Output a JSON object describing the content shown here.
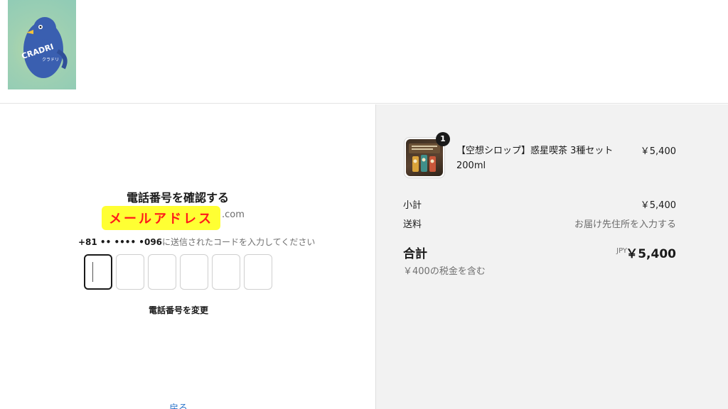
{
  "header": {
    "logo_text": "CRADRI",
    "logo_subtext": "クラドリ"
  },
  "verify": {
    "title": "電話番号を確認する",
    "email_masked": "メールアドレス",
    "email_domain": ".com",
    "phone_masked": "+81 •• •••• •096",
    "sent_message": "に送信されたコードを入力してください",
    "code_digits": [
      "",
      "",
      "",
      "",
      "",
      ""
    ],
    "change_phone_label": "電話番号を変更",
    "back_label": "戻る"
  },
  "summary": {
    "item": {
      "quantity": "1",
      "name": "【空想シロップ】惑星喫茶 3種セット 200ml",
      "price": "￥5,400"
    },
    "subtotal_label": "小計",
    "subtotal_value": "￥5,400",
    "shipping_label": "送料",
    "shipping_value": "お届け先住所を入力する",
    "total_label": "合計",
    "total_currency": "JPY",
    "total_value": "￥5,400",
    "tax_note": "￥400の税金を含む"
  },
  "colors": {
    "highlight_bg": "#ffff33",
    "highlight_text": "#ff1a1a",
    "link": "#2672c9",
    "summary_bg": "#f2f2f2"
  }
}
